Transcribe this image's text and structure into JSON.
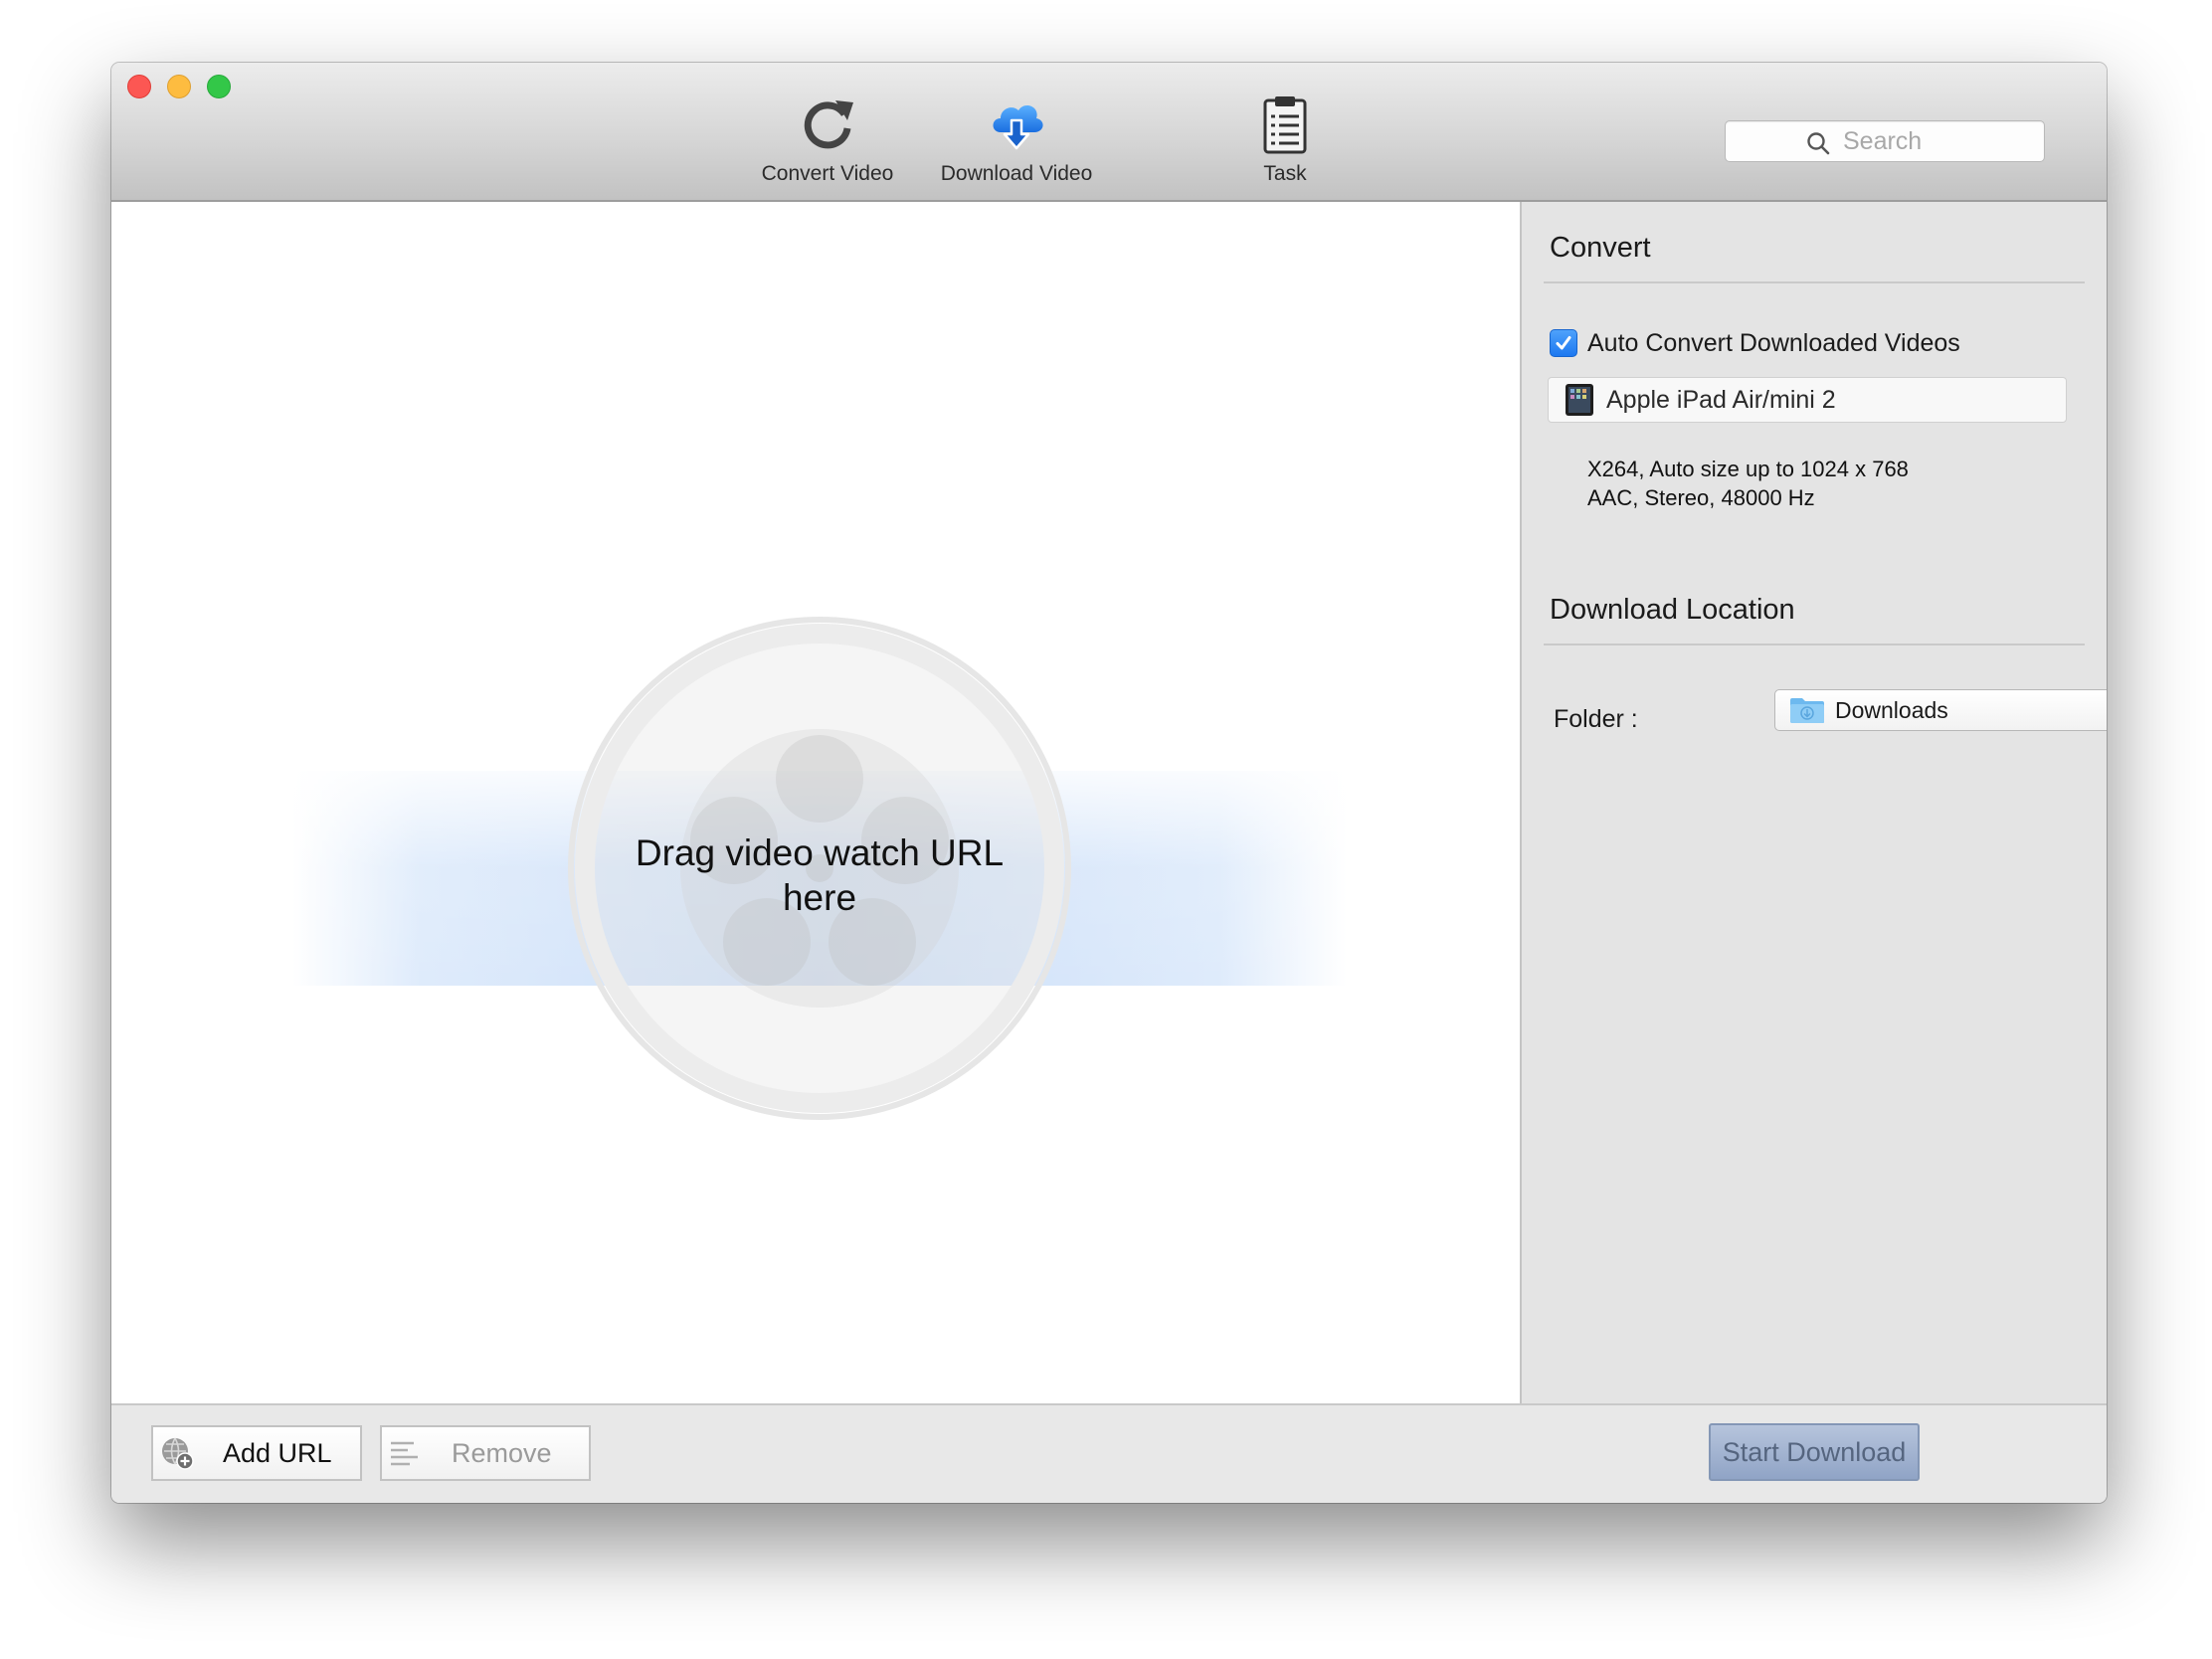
{
  "toolbar": {
    "buttons": [
      {
        "label": "Convert Video",
        "icon": "refresh-icon"
      },
      {
        "label": "Download Video",
        "icon": "cloud-download-icon"
      },
      {
        "label": "Task",
        "icon": "clipboard-icon"
      }
    ],
    "search_placeholder": "Search"
  },
  "main": {
    "drop_hint_line1": "Drag video watch URL",
    "drop_hint_line2": "here"
  },
  "sidebar": {
    "convert": {
      "title": "Convert",
      "auto_convert_label": "Auto Convert Downloaded Videos",
      "auto_convert_checked": true,
      "preset_name": "Apple iPad Air/mini 2",
      "video_spec": "X264, Auto size up to 1024 x 768",
      "audio_spec": "AAC, Stereo, 48000 Hz"
    },
    "download_location": {
      "title": "Download Location",
      "folder_label": "Folder :",
      "folder_value": "Downloads"
    }
  },
  "bottom_bar": {
    "add_url_label": "Add URL",
    "remove_label": "Remove",
    "start_download_label": "Start Download"
  },
  "colors": {
    "accent_blue": "#1c78f0",
    "cloud_blue": "#2a86e8",
    "start_button": "#a3b4d2"
  }
}
